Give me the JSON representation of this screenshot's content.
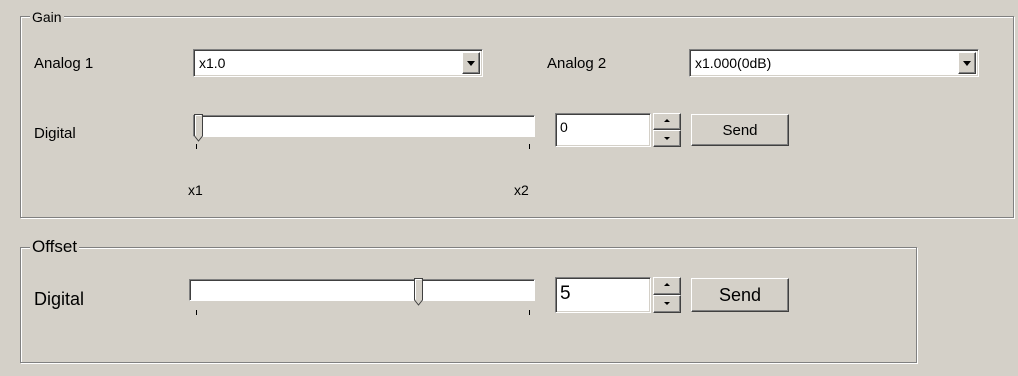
{
  "gain": {
    "title": "Gain",
    "analog1": {
      "label": "Analog 1",
      "value": "x1.0"
    },
    "analog2": {
      "label": "Analog 2",
      "value": "x1.000(0dB)"
    },
    "digital": {
      "label": "Digital",
      "slider_fraction": 0.0,
      "min_label": "x1",
      "max_label": "x2",
      "spin_value": "0",
      "send_label": "Send"
    }
  },
  "offset": {
    "title": "Offset",
    "digital": {
      "label": "Digital",
      "slider_fraction": 0.67,
      "spin_value": "5",
      "send_label": "Send"
    }
  },
  "icons": {
    "combo_arrow": "chevron-down-icon",
    "spin_up": "arrow-up-icon",
    "spin_down": "arrow-down-icon"
  },
  "colors": {
    "face": "#d4d0c8",
    "field": "#ffffff"
  }
}
